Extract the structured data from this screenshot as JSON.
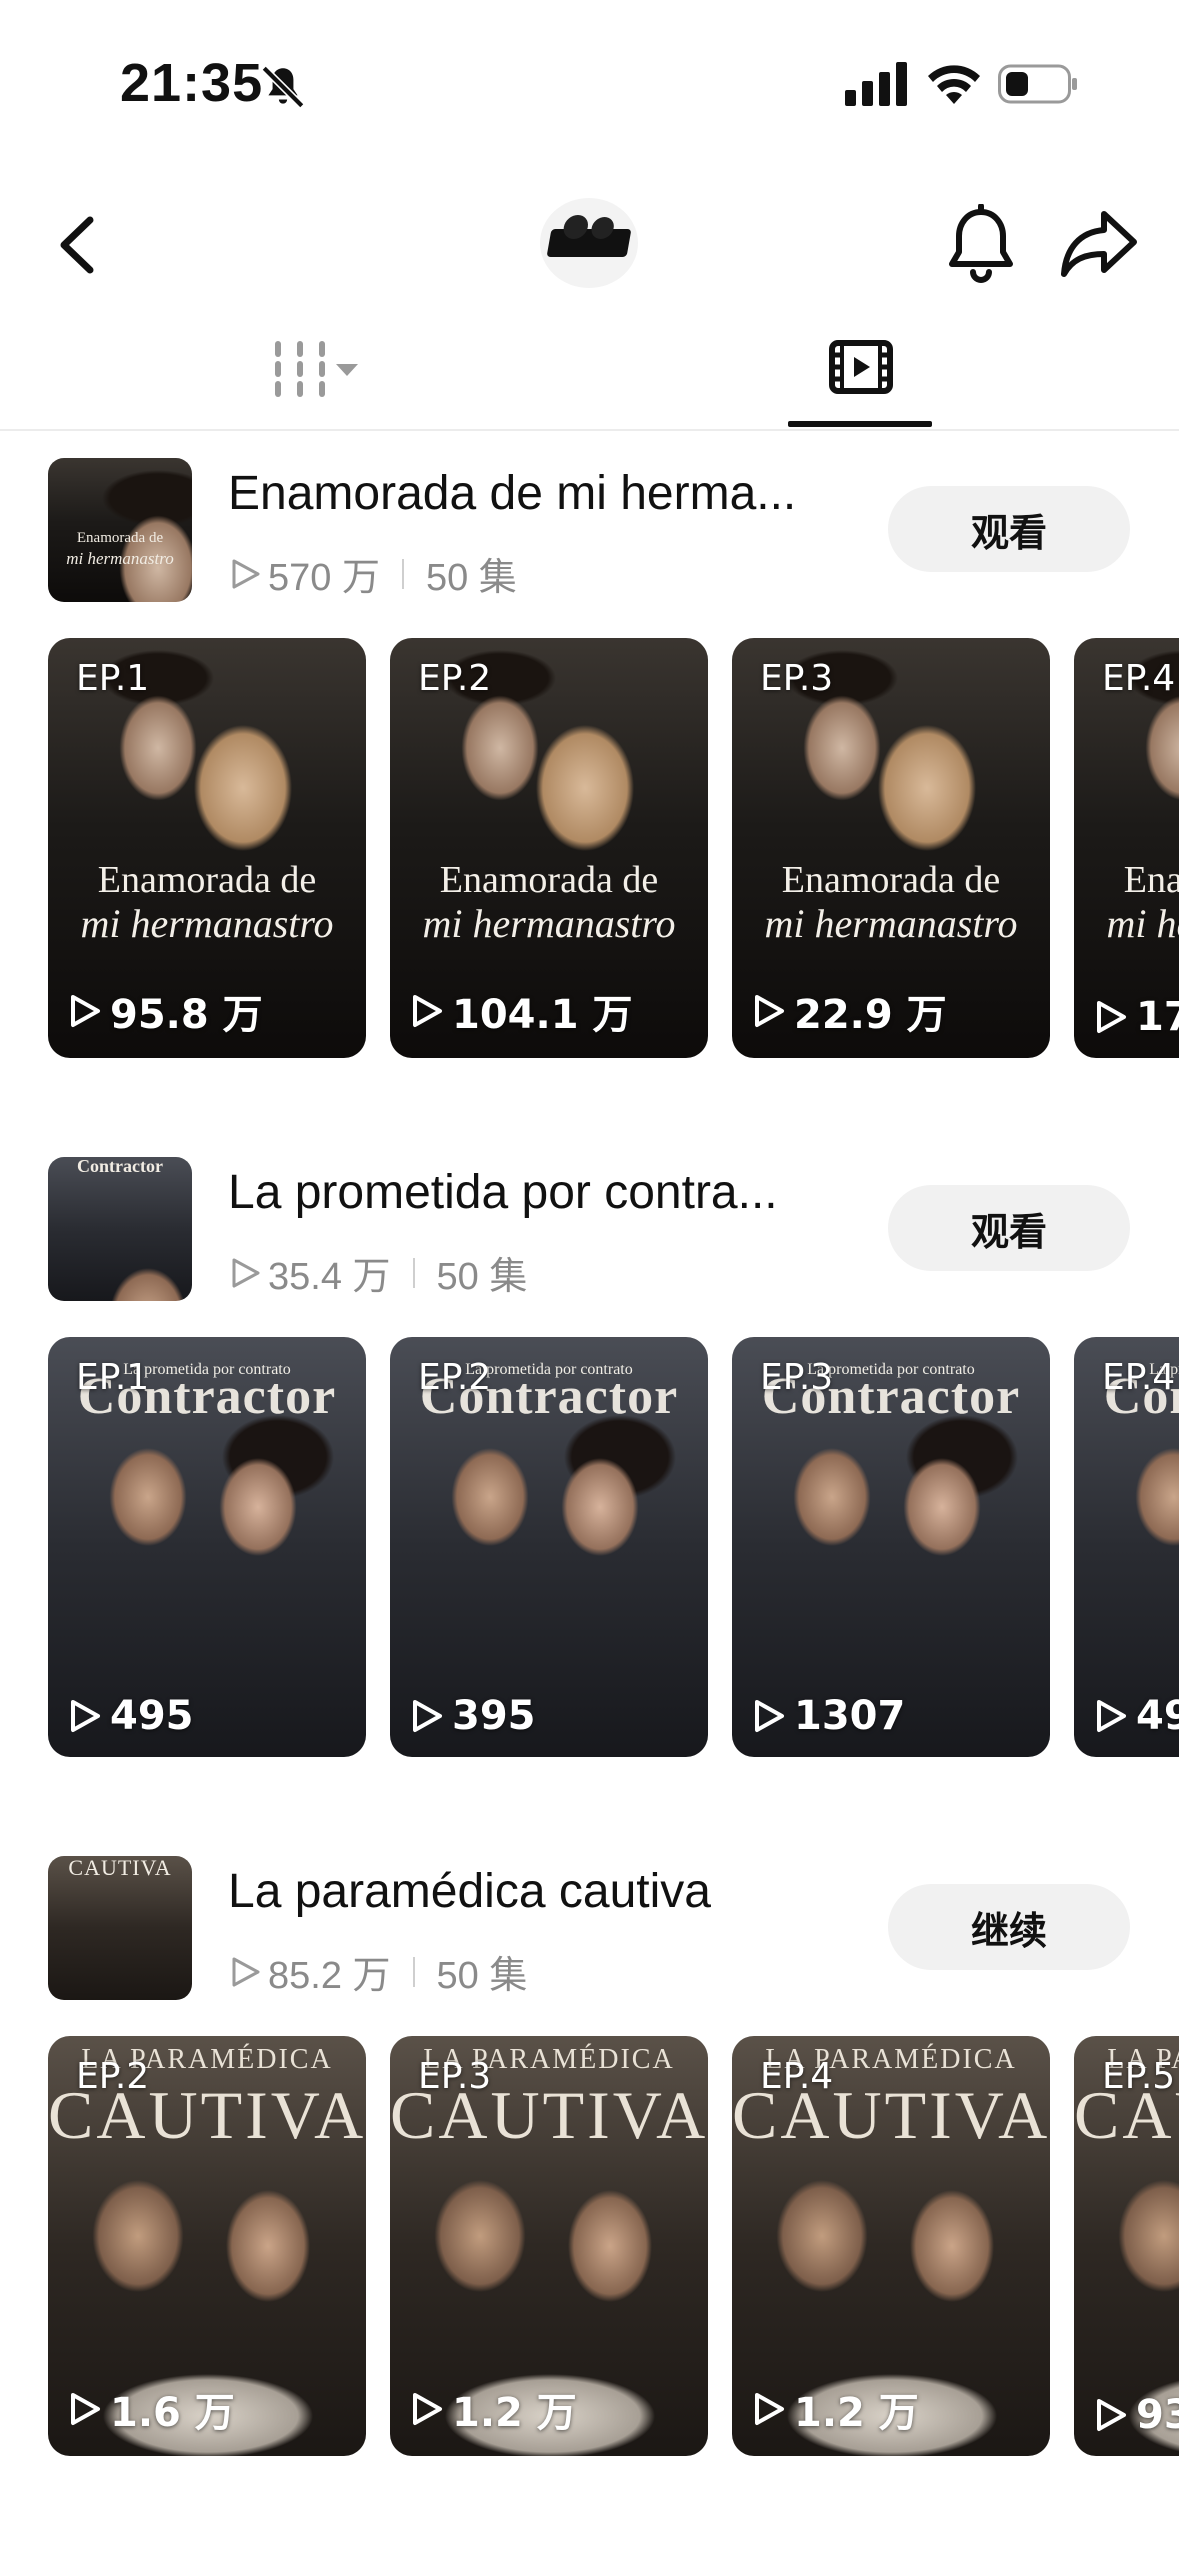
{
  "status_bar": {
    "time": "21:35"
  },
  "nav": {
    "back_icon": "chevron-left-icon",
    "logo": "app-logo",
    "bell_icon": "bell-icon",
    "share_icon": "share-icon"
  },
  "tabs": [
    {
      "icon": "grid-icon",
      "active": false
    },
    {
      "icon": "video-icon",
      "active": true
    }
  ],
  "sections": [
    {
      "title": "Enamorada de mi herma...",
      "plays": "570 万",
      "episodes": "50 集",
      "button": "观看",
      "poster_lines": [
        "Enamorada de",
        "mi hermanastro"
      ],
      "cards": [
        {
          "ep": "EP.1",
          "views": "95.8 万"
        },
        {
          "ep": "EP.2",
          "views": "104.1 万"
        },
        {
          "ep": "EP.3",
          "views": "22.9 万"
        },
        {
          "ep": "EP.4",
          "views": "17"
        }
      ]
    },
    {
      "title": "La prometida por contra...",
      "plays": "35.4 万",
      "episodes": "50 集",
      "button": "观看",
      "poster_lines": [
        "La prometida por contrato",
        "Contractor"
      ],
      "cards": [
        {
          "ep": "EP.1",
          "views": "495"
        },
        {
          "ep": "EP.2",
          "views": "395"
        },
        {
          "ep": "EP.3",
          "views": "1307"
        },
        {
          "ep": "EP.4",
          "views": "49"
        }
      ]
    },
    {
      "title": "La paramédica cautiva",
      "plays": "85.2 万",
      "episodes": "50 集",
      "button": "继续",
      "poster_lines": [
        "LA PARAMÉDICA",
        "CAUTIVA"
      ],
      "cards": [
        {
          "ep": "EP.2",
          "views": "1.6 万"
        },
        {
          "ep": "EP.3",
          "views": "1.2 万"
        },
        {
          "ep": "EP.4",
          "views": "1.2 万"
        },
        {
          "ep": "EP.5",
          "views": "93"
        }
      ]
    }
  ]
}
